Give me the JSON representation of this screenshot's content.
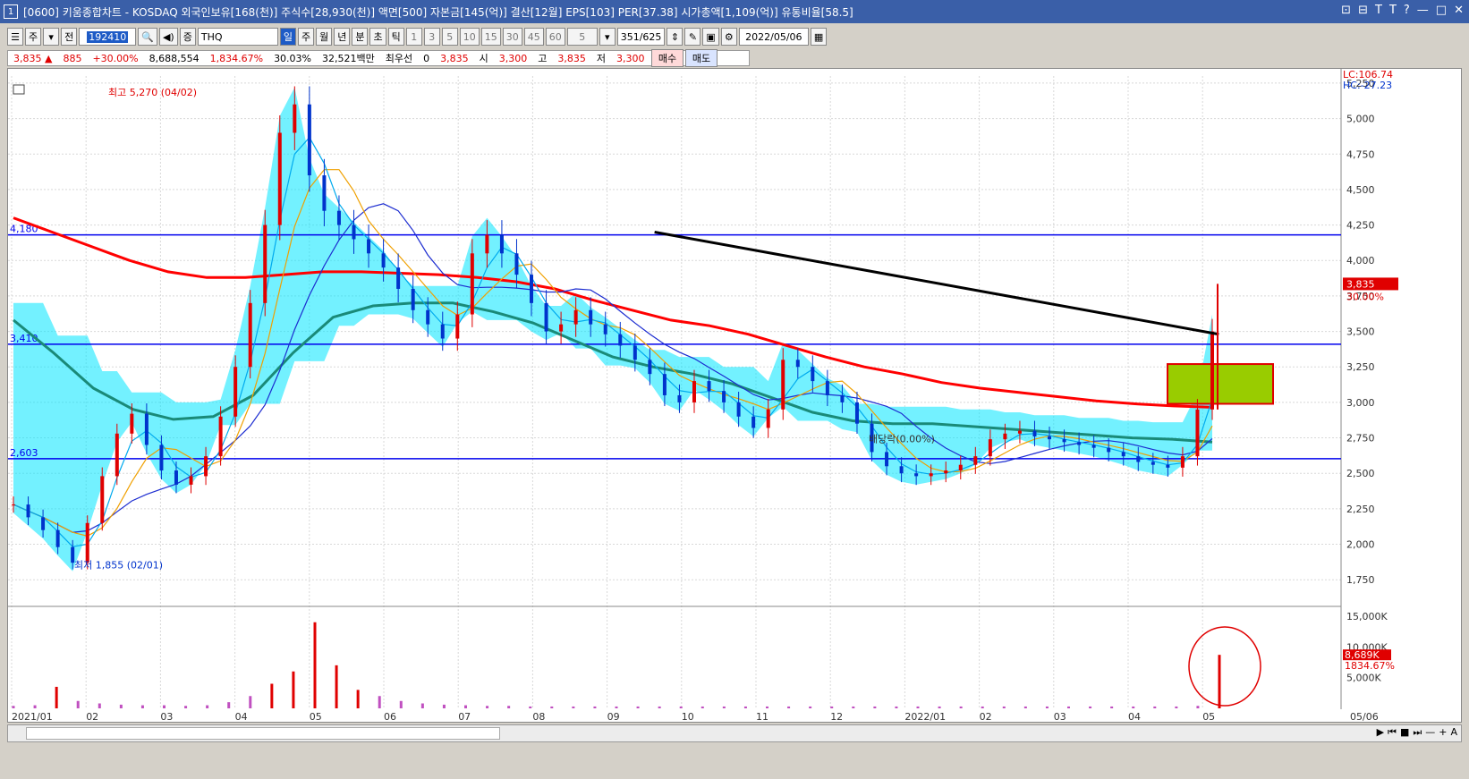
{
  "window": {
    "icon_label": "1",
    "title": "[0600] 키움종합차트 - KOSDAQ 외국인보유[168(천)] 주식수[28,930(천)] 액면[500] 자본금[145(억)] 결산[12월] EPS[103] PER[37.38] 시가총액[1,109(억)] 유통비율[58.5]",
    "controls": [
      "⊡",
      "⊟",
      "T",
      "T",
      "?",
      "—",
      "□",
      "✕"
    ]
  },
  "toolbar": {
    "chart_type": "주",
    "prev_label": "전",
    "code": "192410",
    "stock_name": "THQ",
    "periods": [
      "일",
      "주",
      "월",
      "년",
      "분",
      "초",
      "틱"
    ],
    "active_period": "일",
    "intervals": [
      "1",
      "3",
      "5",
      "10",
      "15",
      "30",
      "45",
      "60"
    ],
    "interval_value": "5",
    "count": "351",
    "count_total": "/625",
    "date": "2022/05/06"
  },
  "quote": {
    "price": "3,835",
    "change": "885",
    "change_pct": "+30.00%",
    "volume": "8,688,554",
    "volume_pct": "1,834.67%",
    "turnover": "30.03%",
    "amount": "32,521백만",
    "bid_label": "최우선",
    "bid_zero": "0",
    "bid_price": "3,835",
    "open_label": "시",
    "open": "3,300",
    "high_label": "고",
    "high": "3,835",
    "low_label": "저",
    "low": "3,300",
    "buy_label": "매수",
    "sell_label": "매도"
  },
  "chart_data": {
    "type": "line",
    "x_months": [
      "2021/01",
      "02",
      "03",
      "04",
      "05",
      "06",
      "07",
      "08",
      "09",
      "10",
      "11",
      "12",
      "2022/01",
      "02",
      "03",
      "04",
      "05"
    ],
    "x_right_label": "05/06",
    "ylim": [
      1600,
      5300
    ],
    "y_ticks": [
      5250,
      5000,
      4750,
      4500,
      4250,
      4000,
      3750,
      3500,
      3250,
      3000,
      2750,
      2500,
      2250,
      2000,
      1750
    ],
    "y_tick_labels": [
      "5,250",
      "5,000",
      "4,750",
      "4,500",
      "4,250",
      "4,000",
      "3,750",
      "3,500",
      "3,250",
      "3,000",
      "2,750",
      "2,500",
      "2,250",
      "2,000",
      "1,750"
    ],
    "lc_label": "LC:106.74",
    "hc_label": "HC:-27.23",
    "last_price_label": "3,835",
    "last_pct_label": "30.00%",
    "h_lines": [
      {
        "value": 4180,
        "label": "4,180"
      },
      {
        "value": 3410,
        "label": "3,410"
      },
      {
        "value": 2603,
        "label": "2,603"
      }
    ],
    "annotations": {
      "high": "최고 5,270 (04/02)",
      "low": "최저 1,855 (02/01)",
      "dividend": "배당락(0.00%)"
    },
    "close": [
      2280,
      2190,
      2100,
      1980,
      1870,
      2150,
      2480,
      2780,
      2920,
      2700,
      2520,
      2420,
      2480,
      2620,
      2900,
      3250,
      3700,
      4250,
      4900,
      5100,
      4600,
      4350,
      4250,
      4150,
      4050,
      3950,
      3800,
      3650,
      3550,
      3450,
      3620,
      4050,
      4180,
      4050,
      3900,
      3700,
      3500,
      3550,
      3650,
      3550,
      3480,
      3400,
      3300,
      3200,
      3050,
      3000,
      3150,
      3080,
      3000,
      2900,
      2820,
      2950,
      3300,
      3250,
      3150,
      3050,
      3000,
      2850,
      2650,
      2550,
      2500,
      2480,
      2500,
      2520,
      2560,
      2620,
      2740,
      2780,
      2800,
      2760,
      2740,
      2720,
      2700,
      2680,
      2650,
      2620,
      2580,
      2560,
      2540,
      2620,
      2950,
      3500
    ],
    "ma_red_240": [
      4300,
      4200,
      4100,
      4000,
      3920,
      3880,
      3880,
      3900,
      3920,
      3920,
      3910,
      3900,
      3880,
      3850,
      3800,
      3720,
      3650,
      3580,
      3540,
      3480,
      3400,
      3320,
      3250,
      3200,
      3140,
      3100,
      3070,
      3040,
      3010,
      2990,
      2975,
      2965
    ],
    "ma_teal_120": [
      3580,
      3350,
      3100,
      2950,
      2880,
      2900,
      3050,
      3350,
      3600,
      3680,
      3700,
      3700,
      3640,
      3560,
      3440,
      3320,
      3250,
      3200,
      3130,
      3030,
      2930,
      2870,
      2850,
      2850,
      2830,
      2810,
      2790,
      2770,
      2750,
      2740,
      2720
    ],
    "trend_black": [
      [
        4200,
        0.485
      ],
      [
        3480,
        0.868
      ]
    ],
    "green_box": {
      "top": 3270,
      "bottom": 2990
    },
    "volume": {
      "ticks": [
        "15,000K",
        "10,000K",
        "5,000K"
      ],
      "last_label": "8,689K",
      "last_pct": "1834.67%",
      "bars": [
        0.4,
        0.5,
        3.5,
        1.2,
        0.8,
        0.6,
        0.5,
        0.5,
        0.4,
        0.5,
        1.0,
        2.0,
        4.0,
        6.0,
        14.0,
        7.0,
        3.0,
        2.0,
        1.2,
        0.8,
        0.6,
        0.5,
        0.4,
        0.4,
        0.3,
        0.3,
        0.3,
        0.3,
        0.3,
        0.3,
        0.3,
        0.3,
        0.3,
        0.3,
        0.3,
        0.3,
        0.3,
        0.3,
        0.3,
        0.3,
        0.3,
        0.3,
        0.3,
        0.3,
        0.3,
        0.3,
        0.3,
        0.3,
        0.3,
        0.3,
        0.3,
        0.3,
        0.3,
        0.3,
        0.3,
        0.4,
        8.7
      ]
    }
  },
  "colors": {
    "up": "#e00000",
    "down": "#0033cc",
    "ma240": "#ff0000",
    "ma120": "#1a8a78",
    "ma60": "#1c2cd0",
    "cloud": "#00e5ff",
    "hline": "#0000ee",
    "trend": "#000000",
    "box": "#99cc00"
  }
}
